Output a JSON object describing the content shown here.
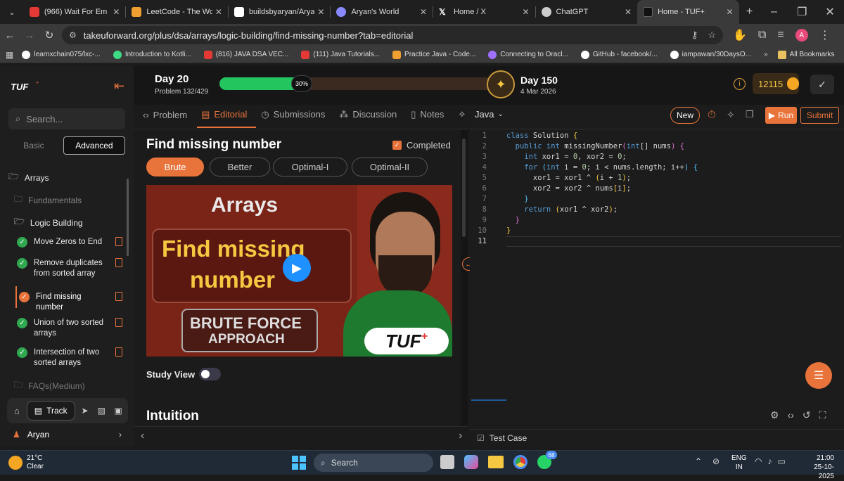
{
  "browser": {
    "tabs": [
      {
        "title": "(966) Wait For Em",
        "color": "#e53935"
      },
      {
        "title": "LeetCode - The World",
        "color": "#f0a030"
      },
      {
        "title": "buildsbyaryan/Aryan",
        "color": "#ffffff"
      },
      {
        "title": "Aryan's World",
        "color": "#8888ff"
      },
      {
        "title": "Home / X",
        "color": "#ffffff"
      },
      {
        "title": "ChatGPT",
        "color": "#cccccc"
      },
      {
        "title": "Home - TUF+",
        "color": "#ffffff"
      }
    ],
    "url": "takeuforward.org/plus/dsa/arrays/logic-building/find-missing-number?tab=editorial",
    "profile_initial": "A",
    "bookmarks": [
      "learnxchain075/lxc-...",
      "Introduction to Kotli...",
      "(816) JAVA DSA VEC...",
      "(111) Java Tutorials...",
      "Practice Java - Code...",
      "Connecting to Oracl...",
      "GitHub - facebook/...",
      "iampawan/30DaysO..."
    ],
    "all_bookmarks": "All Bookmarks"
  },
  "sidebar": {
    "logo": "TUF",
    "search_placeholder": "Search...",
    "toggle": {
      "basic": "Basic",
      "advanced": "Advanced"
    },
    "section": "Arrays",
    "fundamentals": "Fundamentals",
    "logic_building": "Logic Building",
    "problems": [
      "Move Zeros to End",
      "Remove duplicates from sorted array",
      "Find missing number",
      "Union of two sorted arrays",
      "Intersection of two sorted arrays"
    ],
    "faqs": "FAQs(Medium)",
    "track": "Track",
    "user": "Aryan"
  },
  "progress": {
    "day": "Day 20",
    "problem": "Problem 132/429",
    "percent_label": "30%",
    "percent": 30,
    "goal_day": "Day 150",
    "goal_date": "4 Mar 2026",
    "coins": "12115"
  },
  "tabs": {
    "problem": "Problem",
    "editorial": "Editorial",
    "submissions": "Submissions",
    "discussion": "Discussion",
    "notes": "Notes"
  },
  "editorial": {
    "title": "Find missing number",
    "completed": "Completed",
    "approaches": [
      "Brute",
      "Better",
      "Optimal-I",
      "Optimal-II"
    ],
    "thumbnail": {
      "top": "Arrays",
      "line1": "Find missing",
      "line2": "number",
      "sub1": "BRUTE FORCE",
      "sub2": "APPROACH",
      "brand": "TUF"
    },
    "study_view": "Study View",
    "intuition": "Intuition"
  },
  "editor": {
    "language": "Java",
    "new_label": "New",
    "run_label": "Run",
    "submit_label": "Submit",
    "line_numbers": [
      "1",
      "2",
      "3",
      "4",
      "5",
      "6",
      "7",
      "8",
      "9",
      "10",
      "11"
    ],
    "test_case": "Test Case"
  },
  "taskbar": {
    "temp": "21°C",
    "weather": "Clear",
    "search": "Search",
    "lang1": "ENG",
    "lang2": "IN",
    "time": "21:00",
    "date": "25-10-2025",
    "whatsapp_badge": "68"
  }
}
